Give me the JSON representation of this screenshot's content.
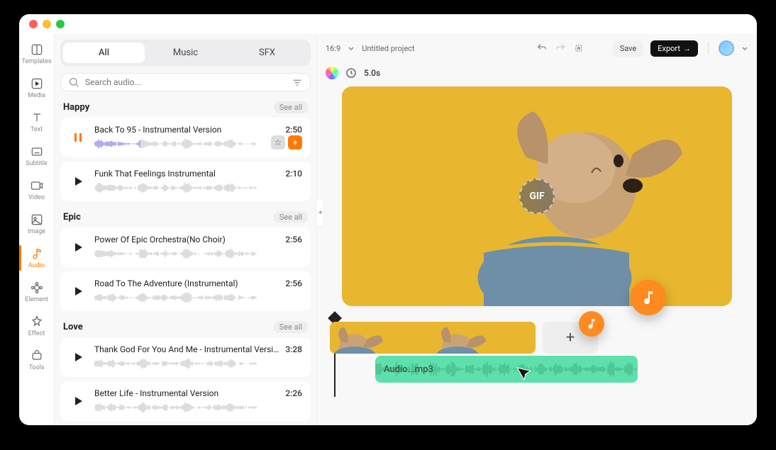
{
  "sidebar": {
    "items": [
      {
        "key": "templates",
        "label": "Templates"
      },
      {
        "key": "media",
        "label": "Media"
      },
      {
        "key": "text",
        "label": "Text"
      },
      {
        "key": "subtitle",
        "label": "Subtitle"
      },
      {
        "key": "video",
        "label": "Video"
      },
      {
        "key": "image",
        "label": "Image"
      },
      {
        "key": "audio",
        "label": "Audio"
      },
      {
        "key": "element",
        "label": "Element"
      },
      {
        "key": "effect",
        "label": "Effect"
      },
      {
        "key": "tools",
        "label": "Tools"
      }
    ],
    "active": "audio"
  },
  "tabs": {
    "items": [
      "All",
      "Music",
      "SFX"
    ],
    "active": "All"
  },
  "search": {
    "placeholder": "Search audio..."
  },
  "categories": [
    {
      "name": "Happy",
      "see": "See all",
      "tracks": [
        {
          "title": "Back To 95 - Instrumental Version",
          "dur": "2:50",
          "playing": true,
          "showadd": true
        },
        {
          "title": "Funk That Feelings Instrumental",
          "dur": "2:10",
          "playing": false
        }
      ]
    },
    {
      "name": "Epic",
      "see": "See all",
      "tracks": [
        {
          "title": "Power Of Epic Orchestra(No Choir)",
          "dur": "2:56",
          "playing": false
        },
        {
          "title": "Road To The Adventure (Instrumental)",
          "dur": "2:56",
          "playing": false
        }
      ]
    },
    {
      "name": "Love",
      "see": "See all",
      "tracks": [
        {
          "title": "Thank God For You And Me - Instrumental Version",
          "dur": "3:28",
          "playing": false
        },
        {
          "title": "Better Life - Instrumental Version",
          "dur": "2:26",
          "playing": false
        }
      ]
    }
  ],
  "topbar": {
    "ratio": "16:9",
    "project": "Untitled project",
    "save": "Save",
    "export": "Export"
  },
  "meta": {
    "duration": "5.0s"
  },
  "preview": {
    "badge": "GIF"
  },
  "timeline": {
    "audio": "Audio...mp3",
    "add": "+"
  }
}
